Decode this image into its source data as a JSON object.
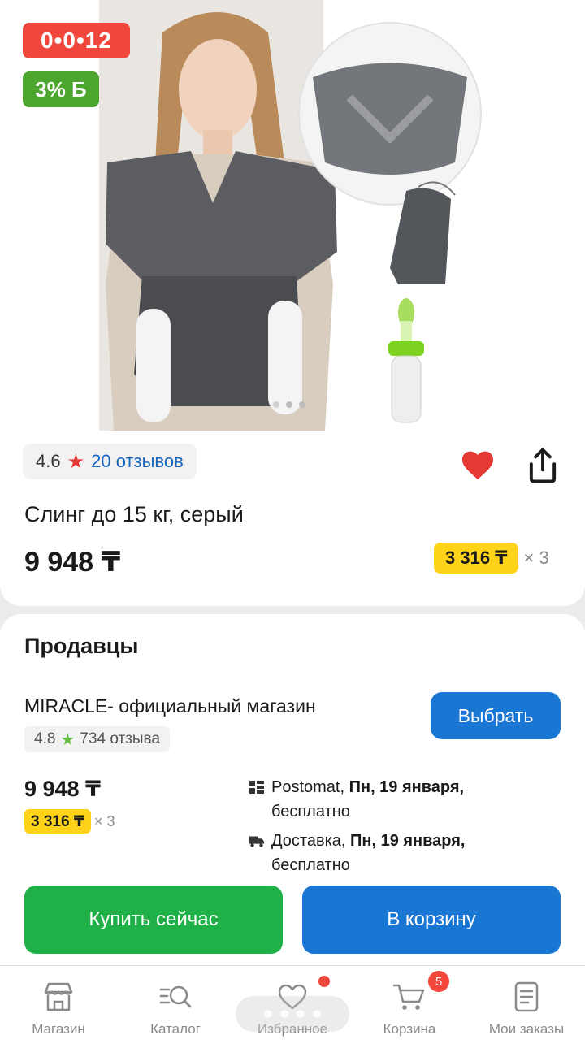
{
  "product": {
    "timer": "0•0•12",
    "bonus": "3% Б",
    "rating": "4.6",
    "reviews": "20 отзывов",
    "title": "Слинг до 15 кг, серый",
    "price": "9 948 ₸",
    "installment_amount": "3 316 ₸",
    "installment_times": "× 3",
    "image_page": 1,
    "image_pages_total": 3
  },
  "sellers": {
    "title": "Продавцы",
    "shop_name": "MIRACLE- официальный магазин",
    "shop_rating": "4.8",
    "shop_reviews": "734 отзыва",
    "choose_label": "Выбрать",
    "price": "9 948 ₸",
    "installment_amount": "3 316 ₸",
    "installment_times": "× 3",
    "delivery": [
      {
        "icon": "postomat-icon",
        "method": "Postomat, ",
        "date": "Пн, 19 января,",
        "cost": "бесплатно"
      },
      {
        "icon": "truck-icon",
        "method": "Доставка, ",
        "date": "Пн, 19 января,",
        "cost": "бесплатно"
      }
    ]
  },
  "actions": {
    "buy_now": "Купить сейчас",
    "to_cart": "В корзину"
  },
  "tabbar": {
    "items": [
      {
        "label": "Магазин",
        "icon": "store-icon"
      },
      {
        "label": "Каталог",
        "icon": "catalog-search-icon"
      },
      {
        "label": "Избранное",
        "icon": "heart-outline-icon"
      },
      {
        "label": "Корзина",
        "icon": "cart-icon",
        "badge": "5"
      },
      {
        "label": "Мои заказы",
        "icon": "orders-icon"
      }
    ]
  },
  "colors": {
    "accent_blue": "#1976d2",
    "buy_green": "#20b048",
    "timer_red": "#f0463c",
    "bonus_green": "#4ca52d",
    "installment_yellow": "#ffd31a"
  }
}
